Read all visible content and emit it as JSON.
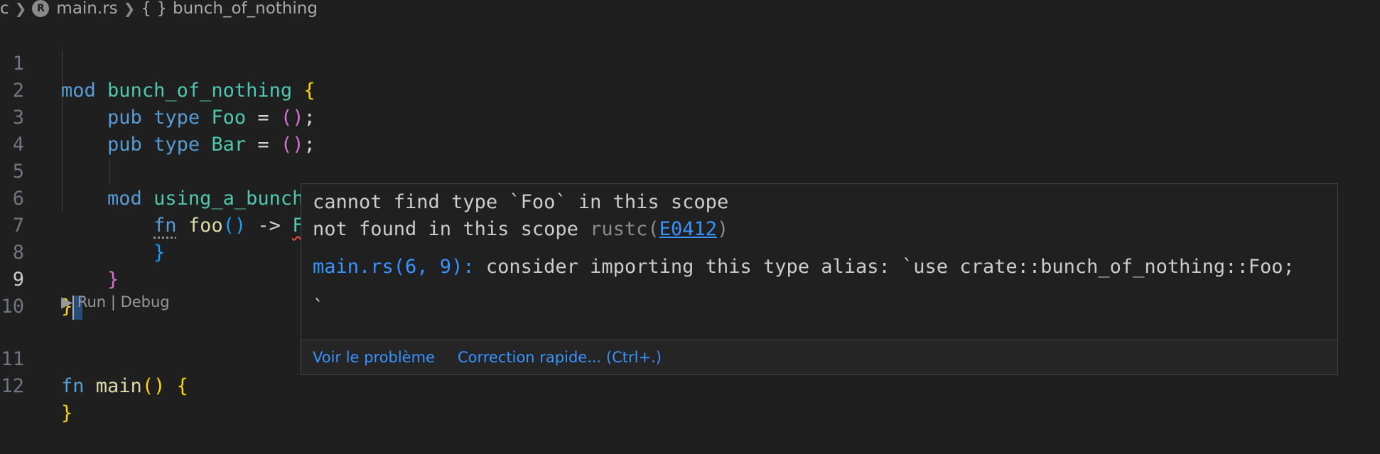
{
  "breadcrumb": {
    "folder_fragment": "c",
    "file": "main.rs",
    "symbol": "bunch_of_nothing",
    "file_icon": "rust-file-icon",
    "symbol_icon": "braces-icon"
  },
  "editor": {
    "line_numbers": [
      "1",
      "2",
      "3",
      "4",
      "5",
      "6",
      "7",
      "8",
      "9",
      "10",
      "11",
      "12"
    ],
    "active_line": "9",
    "codelens": {
      "run": "Run",
      "separator": "|",
      "debug": "Debug"
    },
    "tokens": {
      "mod": "mod",
      "pub": "pub",
      "type": "type",
      "fn": "fn",
      "bunch_of_nothing": "bunch_of_nothing",
      "using_a_bunch_of_nothing": "using_a_bunch_of_nothing",
      "foo_type": "Foo",
      "bar_type": "Bar",
      "foo_fn": "foo",
      "main_fn": "main",
      "eq": "=",
      "semi": ";",
      "arrow": "->",
      "open_brace": "{",
      "close_brace": "}",
      "open_paren": "(",
      "close_paren": ")"
    }
  },
  "hover": {
    "line1": "cannot find type `Foo` in this scope",
    "line2_prefix": "not found in this scope",
    "source": "rustc(",
    "code": "E0412",
    "source_close": ")",
    "location": "main.rs(6, 9):",
    "suggestion": "consider importing this type alias: `use crate::bunch_of_nothing::Foo;",
    "backtick": "`",
    "action_view": "Voir le problème",
    "action_fix": "Correction rapide... (Ctrl+.)"
  },
  "colors": {
    "background": "#1f1f1f",
    "keyword": "#569cd6",
    "type": "#4ec9b0",
    "function": "#dcdcaa",
    "bracket_level1": "#ffd700",
    "bracket_level2": "#da70d6",
    "bracket_level3": "#179fff",
    "error": "#f14c4c",
    "link": "#3794ff"
  }
}
